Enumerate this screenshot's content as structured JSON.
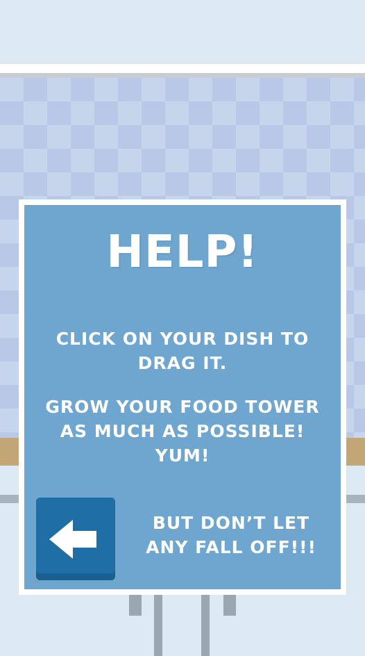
{
  "help": {
    "title": "HELP!",
    "instruction_1": "Click on your dish to drag it.",
    "instruction_2": "Grow your food tower as much as possible! Yum!",
    "instruction_3": "But don’t let any fall off!!!"
  },
  "back_button": {
    "icon": "arrow-left-icon"
  },
  "colors": {
    "panel": "#6ea6cf",
    "panel_border": "#ffffff",
    "button": "#1f6fa6",
    "counter": "#c3a676",
    "wall_check": "#c6d4ec"
  }
}
